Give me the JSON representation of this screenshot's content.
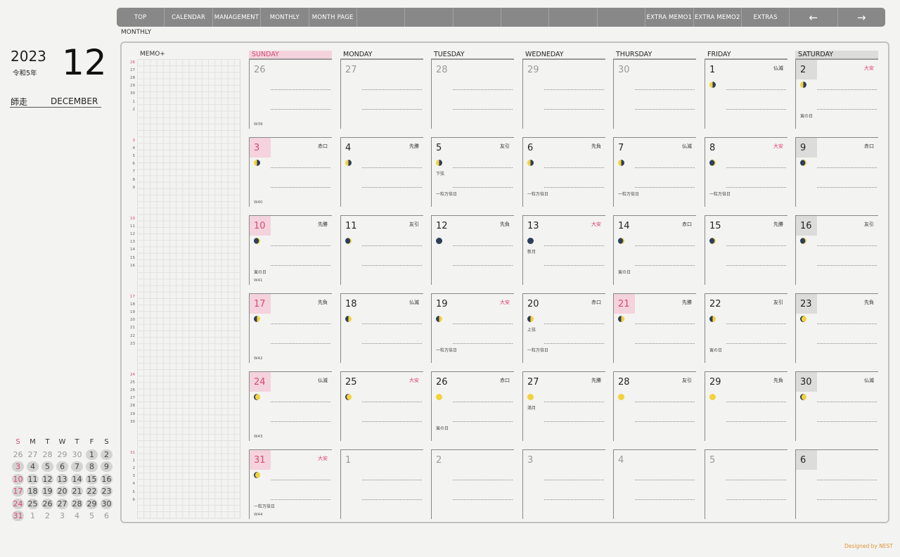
{
  "nav": [
    "TOP",
    "CALENDAR",
    "MANAGEMENT",
    "MONTHLY",
    "MONTH PAGE",
    "",
    "",
    "",
    "",
    "",
    "",
    "EXTRA MEMO1",
    "EXTRA MEMO2",
    "EXTRAS",
    "←",
    "→"
  ],
  "page_label": "MONTHLY",
  "year": "2023",
  "era": "令和5年",
  "month_num": "12",
  "month_jp": "師走",
  "month_en": "DECEMBER",
  "memo_label": "MEMO+",
  "weekdays": [
    "SUNDAY",
    "MONDAY",
    "TUESDAY",
    "WEDNEDAY",
    "THURSDAY",
    "FRIDAY",
    "SATURDAY"
  ],
  "memo_rows": [
    [
      "26",
      "27",
      "28",
      "29",
      "30",
      "1",
      "2"
    ],
    [
      "3",
      "4",
      "5",
      "6",
      "7",
      "8",
      "9"
    ],
    [
      "10",
      "11",
      "12",
      "13",
      "14",
      "15",
      "16"
    ],
    [
      "17",
      "18",
      "19",
      "20",
      "21",
      "22",
      "23"
    ],
    [
      "24",
      "25",
      "26",
      "27",
      "28",
      "29",
      "30"
    ],
    [
      "31",
      "1",
      "2",
      "3",
      "4",
      "5",
      "6"
    ]
  ],
  "mini_headers": [
    "S",
    "M",
    "T",
    "W",
    "T",
    "F",
    "S"
  ],
  "mini_weeks": [
    [
      "26",
      "27",
      "28",
      "29",
      "30",
      "1",
      "2"
    ],
    [
      "3",
      "4",
      "5",
      "6",
      "7",
      "8",
      "9"
    ],
    [
      "10",
      "11",
      "12",
      "13",
      "14",
      "15",
      "16"
    ],
    [
      "17",
      "18",
      "19",
      "20",
      "21",
      "22",
      "23"
    ],
    [
      "24",
      "25",
      "26",
      "27",
      "28",
      "29",
      "30"
    ],
    [
      "31",
      "1",
      "2",
      "3",
      "4",
      "5",
      "6"
    ]
  ],
  "weeks": [
    {
      "wk": "W39",
      "days": [
        {
          "d": "26",
          "other": true
        },
        {
          "d": "27",
          "other": true
        },
        {
          "d": "28",
          "other": true
        },
        {
          "d": "29",
          "other": true
        },
        {
          "d": "30",
          "other": true
        },
        {
          "d": "1",
          "rk": "仏滅",
          "moon": "wan"
        },
        {
          "d": "2",
          "rk": "大安",
          "moon": "wan",
          "notes": [
            "寅の日"
          ]
        }
      ]
    },
    {
      "wk": "W40",
      "days": [
        {
          "d": "3",
          "rk": "赤口",
          "moon": "wan"
        },
        {
          "d": "4",
          "rk": "先勝",
          "moon": "wan"
        },
        {
          "d": "5",
          "rk": "友引",
          "moon": "wan",
          "notes": [
            "下弦",
            "一粒万倍日"
          ]
        },
        {
          "d": "6",
          "rk": "先負",
          "moon": "wan",
          "notes": [
            "一粒万倍日"
          ]
        },
        {
          "d": "7",
          "rk": "仏滅",
          "moon": "wan",
          "notes": [
            "一粒万倍日"
          ]
        },
        {
          "d": "8",
          "rk": "大安",
          "moon": "cres",
          "notes": [
            "一粒万倍日"
          ]
        },
        {
          "d": "9",
          "rk": "赤口",
          "moon": "cres"
        }
      ]
    },
    {
      "wk": "W41",
      "days": [
        {
          "d": "10",
          "rk": "先勝",
          "moon": "cres",
          "notes": [
            "寅の日"
          ]
        },
        {
          "d": "11",
          "rk": "友引",
          "moon": "cres"
        },
        {
          "d": "12",
          "rk": "先負",
          "moon": "new"
        },
        {
          "d": "13",
          "rk": "大安",
          "moon": "new",
          "notes": [
            "新月"
          ]
        },
        {
          "d": "14",
          "rk": "赤口",
          "moon": "cres",
          "notes": [
            "寅の日"
          ]
        },
        {
          "d": "15",
          "rk": "先勝",
          "moon": "cres"
        },
        {
          "d": "16",
          "rk": "友引",
          "moon": "cres"
        }
      ]
    },
    {
      "wk": "W42",
      "days": [
        {
          "d": "17",
          "rk": "先負",
          "moon": "wax"
        },
        {
          "d": "18",
          "rk": "仏滅",
          "moon": "wax"
        },
        {
          "d": "19",
          "rk": "大安",
          "moon": "wax",
          "notes": [
            "一粒万倍日"
          ]
        },
        {
          "d": "20",
          "rk": "赤口",
          "moon": "wax",
          "notes": [
            "上弦",
            "一粒万倍日"
          ]
        },
        {
          "d": "21",
          "rk": "先勝",
          "moon": "wax",
          "holiday": true
        },
        {
          "d": "22",
          "rk": "友引",
          "moon": "wax",
          "notes": [
            "寅の日"
          ]
        },
        {
          "d": "23",
          "rk": "先負",
          "moon": "gib"
        }
      ]
    },
    {
      "wk": "W43",
      "days": [
        {
          "d": "24",
          "rk": "仏滅",
          "moon": "gib"
        },
        {
          "d": "25",
          "rk": "大安",
          "moon": "gib"
        },
        {
          "d": "26",
          "rk": "赤口",
          "moon": "full",
          "notes": [
            "寅の日"
          ]
        },
        {
          "d": "27",
          "rk": "先勝",
          "moon": "full",
          "notes": [
            "満月"
          ]
        },
        {
          "d": "28",
          "rk": "友引",
          "moon": "full"
        },
        {
          "d": "29",
          "rk": "先負",
          "moon": "full"
        },
        {
          "d": "30",
          "rk": "仏滅",
          "moon": "gib"
        }
      ]
    },
    {
      "wk": "W44",
      "days": [
        {
          "d": "31",
          "rk": "大安",
          "moon": "gib",
          "notes": [
            "一粒万倍日"
          ]
        },
        {
          "d": "1",
          "other": true
        },
        {
          "d": "2",
          "other": true
        },
        {
          "d": "3",
          "other": true
        },
        {
          "d": "4",
          "other": true
        },
        {
          "d": "5",
          "other": true
        },
        {
          "d": "6",
          "other": true
        }
      ]
    }
  ],
  "credit": "Designed by NEST",
  "colors": {
    "accent_pink": "#d64a73",
    "taian_red": "#e03a6a",
    "sunday_bg": "#f4d3de",
    "saturday_bg": "#dcdcda",
    "nav_bg": "#878887"
  }
}
